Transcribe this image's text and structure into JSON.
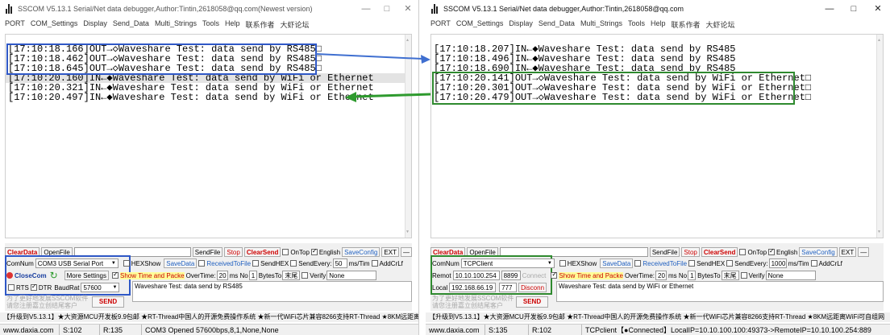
{
  "left": {
    "title": "SSCOM V5.13.1 Serial/Net data debugger,Author:Tintin,2618058@qq.com(Newest version)",
    "window_buttons": [
      "—",
      "□",
      "✕"
    ],
    "menu": [
      "PORT",
      "COM_Settings",
      "Display",
      "Send_Data",
      "Multi_Strings",
      "Tools",
      "Help",
      "联系作者",
      "大虾论坛"
    ],
    "log": [
      "[17:10:18.166]OUT→◇Waveshare Test: data send by RS485□",
      "[17:10:18.462]OUT→◇Waveshare Test: data send by RS485□",
      "[17:10:18.645]OUT→◇Waveshare Test: data send by RS485□",
      "[17:10:20.160]IN←◆Waveshare Test: data send by WiFi or Ethernet",
      "[17:10:20.321]IN←◆Waveshare Test: data send by WiFi or Ethernet",
      "[17:10:20.497]IN←◆Waveshare Test: data send by WiFi or Ethernet"
    ],
    "toolbar": {
      "clear": "ClearData",
      "open": "OpenFile",
      "sendfile": "SendFile",
      "stop": "Stop",
      "clearsend": "ClearSend",
      "ontop": "OnTop",
      "english": "English",
      "saveconfig": "SaveConfig",
      "ext": "EXT",
      "minus": "—"
    },
    "port": {
      "label": "ComNum",
      "value": "COM3 USB Serial Port",
      "hexshow": "HEXShow",
      "savedata": "SaveData",
      "recvfile": "ReceivedToFile",
      "sendhex": "SendHEX",
      "sendevery": "SendEvery:",
      "every_val": "50",
      "every_unit": "ms/Tim",
      "addcrlf": "AddCrLf",
      "close": "CloseCom",
      "more": "More Settings",
      "showtime": "Show Time and Packe",
      "overtime": "OverTime:",
      "overtime_val": "20",
      "ms_no": "ms No",
      "no_val": "1",
      "bytesto": "BytesTo",
      "bytesto_val": "末尾",
      "verify": "Verify",
      "verify_val": "None",
      "rts": "RTS",
      "dtr": "DTR",
      "baud_label": "BaudRat",
      "baud_val": "57600",
      "send_text": "Waveshare Test: data send by RS485",
      "send_btn": "SEND",
      "note1": "为了更好地发展SSCOM软件",
      "note2": "请您注册嘉立创结尾客户"
    },
    "marquee": "【升级到V5.13.1】★大资源MCU开发板9.9包邮 ★RT-Thread中国人的开源免费操作系统 ★新一代WiFi芯片兼容8266支持RT-Thread ★8KM远距离WiFi",
    "status": [
      "www.daxia.com",
      "S:102",
      "R:135",
      "COM3 Opened  57600bps,8,1,None,None"
    ]
  },
  "right": {
    "title": "SSCOM V5.13.1 Serial/Net data debugger,Author:Tintin,2618058@qq.com",
    "window_buttons": [
      "—",
      "□",
      "✕"
    ],
    "menu": [
      "PORT",
      "COM_Settings",
      "Display",
      "Send_Data",
      "Multi_Strings",
      "Tools",
      "Help",
      "联系作者",
      "大虾论坛"
    ],
    "log": [
      "[17:10:18.207]IN←◆Waveshare Test: data send by RS485",
      "[17:10:18.496]IN←◆Waveshare Test: data send by RS485",
      "[17:10:18.690]IN←◆Waveshare Test: data send by RS485",
      "[17:10:20.141]OUT→◇Waveshare Test: data send by WiFi or Ethernet□",
      "[17:10:20.301]OUT→◇Waveshare Test: data send by WiFi or Ethernet□",
      "[17:10:20.479]OUT→◇Waveshare Test: data send by WiFi or Ethernet□"
    ],
    "toolbar": {
      "clear": "ClearData",
      "open": "OpenFile",
      "sendfile": "SendFile",
      "stop": "Stop",
      "clearsend": "ClearSend",
      "ontop": "OnTop",
      "english": "English",
      "saveconfig": "SaveConfig",
      "ext": "EXT",
      "minus": "—"
    },
    "net": {
      "label": "ComNum",
      "value": "TCPClient",
      "remote_label": "Remot",
      "remote_ip": "10.10.100.254",
      "remote_port": "8899",
      "connect": "Connect",
      "local_label": "Local",
      "local_ip": "192.168.66.19",
      "local_port": "777",
      "disconnect": "Disconn",
      "hexshow": "HEXShow",
      "savedata": "SaveData",
      "recvfile": "ReceivedToFile",
      "sendhex": "SendHEX",
      "sendevery": "SendEvery:",
      "every_val": "1000",
      "every_unit": "ms/Tim",
      "addcrlf": "AddCrLf",
      "showtime": "Show Time and Packe",
      "overtime": "OverTime:",
      "overtime_val": "20",
      "ms_no": "ms No",
      "no_val": "1",
      "bytesto": "BytesTo",
      "bytesto_val": "末尾",
      "verify": "Verify",
      "verify_val": "None",
      "send_text": "Waveshare Test: data send by WiFi or Ethernet",
      "send_btn": "SEND",
      "note1": "为了更好地发展SSCOM软件",
      "note2": "请您注册嘉立创结尾客户"
    },
    "marquee": "【升级到V5.13.1】★大资源MCU开发板9.9包邮 ★RT-Thread中国人的开源免费操作系统 ★新一代WiFi芯片兼容8266支持RT-Thread ★8KM远距离WiFi可自组网",
    "status": [
      "www.daxia.com",
      "S:135",
      "R:102",
      "TCPclient【●Connected】LocalIP=10.10.100.100:49373->RemoteIP=10.10.100.254:889"
    ]
  },
  "colors": {
    "blue_box": "#2f58c6",
    "green_box": "#2f8a2f",
    "arrow_blue": "#3f6fd0",
    "arrow_green": "#2e9a2e"
  }
}
